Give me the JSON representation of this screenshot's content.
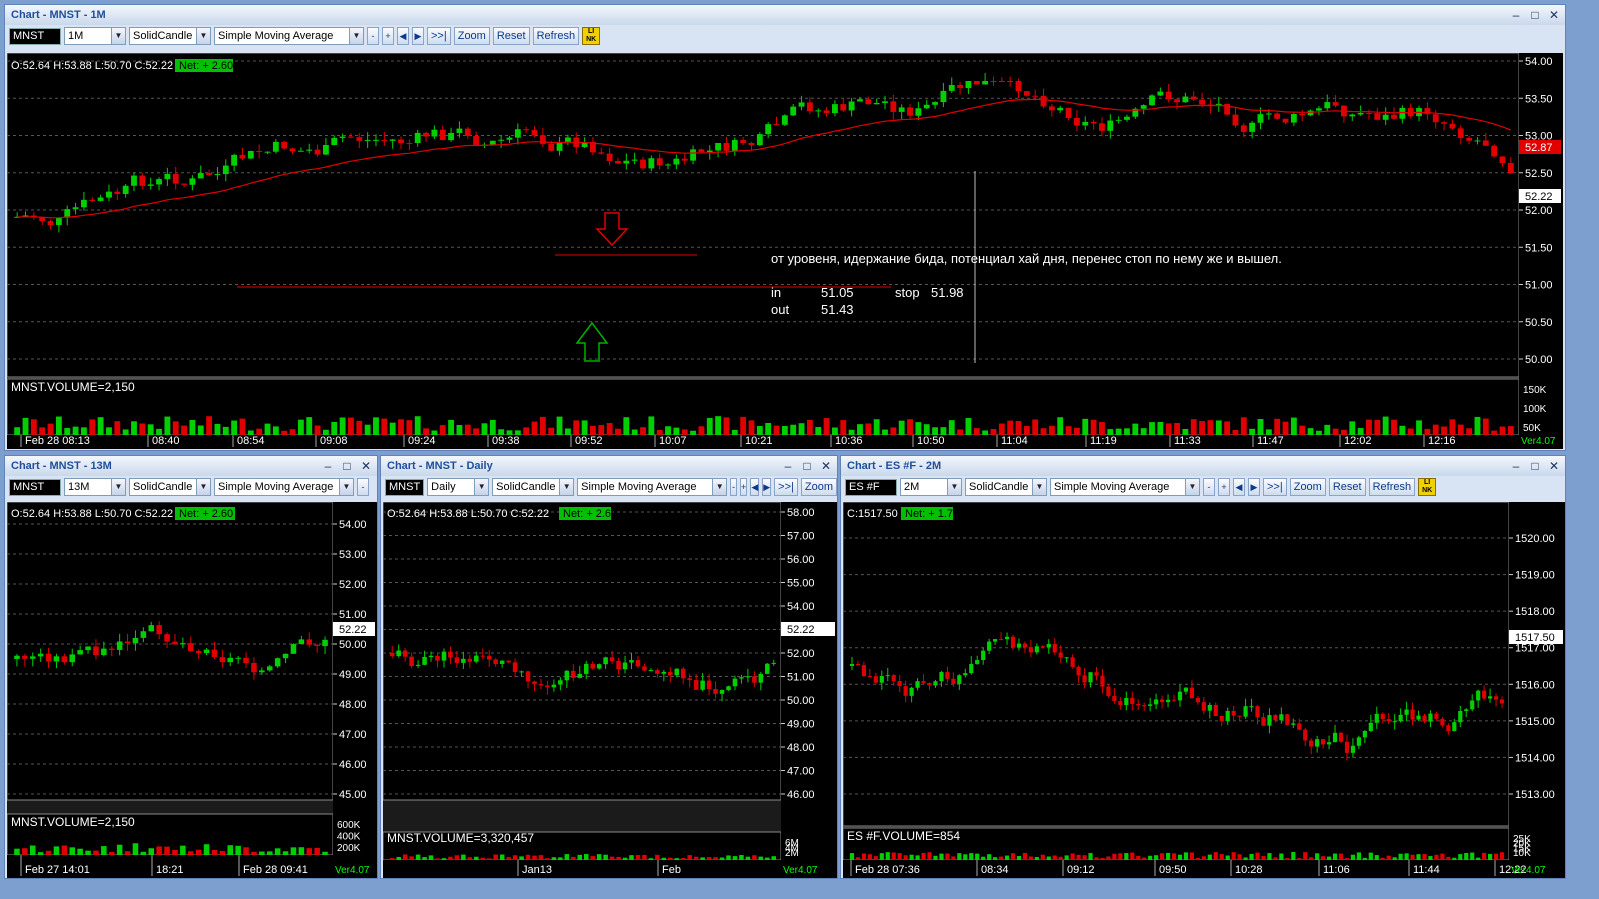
{
  "windows": [
    {
      "id": "w1",
      "title": "Chart - MNST - 1M",
      "symbol": "MNST",
      "interval": "1M",
      "style": "SolidCandle",
      "study": "Simple Moving Average",
      "buttons": [
        "Zoom",
        "Reset",
        "Refresh"
      ],
      "ohlc": "O:52.64  H:53.88  L:50.70  C:52.22",
      "net": "Net: + 2.60",
      "vol_label": "MNST.VOLUME=2,150",
      "price_ticks": [
        "54.00",
        "53.50",
        "53.00",
        "52.50",
        "52.00",
        "51.50",
        "51.00",
        "50.50",
        "50.00"
      ],
      "vol_ticks": [
        "150K",
        "100K",
        "50K"
      ],
      "time_ticks": [
        "Feb 28 08:13",
        "08:40",
        "08:54",
        "09:08",
        "09:24",
        "09:38",
        "09:52",
        "10:07",
        "10:21",
        "10:36",
        "10:50",
        "11:04",
        "11:19",
        "11:33",
        "11:47",
        "12:02",
        "12:16"
      ],
      "last_price": "52.22",
      "ma_price": "52.87",
      "ver": "Ver4.07",
      "annotation": {
        "comment": "от уровеня,  идержание бида, потенциал хай дня, перенес стоп по нему же и вышел.",
        "in_label": "in",
        "in_value": "51.05",
        "stop_label": "stop",
        "stop_value": "51.98",
        "out_label": "out",
        "out_value": "51.43"
      }
    },
    {
      "id": "w2",
      "title": "Chart - MNST - 13M",
      "symbol": "MNST",
      "interval": "13M",
      "style": "SolidCandle",
      "study": "Simple Moving Average",
      "ohlc": "O:52.64  H:53.88  L:50.70  C:52.22",
      "net": "Net: + 2.60",
      "vol_label": "MNST.VOLUME=2,150",
      "price_ticks": [
        "54.00",
        "53.00",
        "52.00",
        "51.00",
        "50.00",
        "49.00",
        "48.00",
        "47.00",
        "46.00",
        "45.00"
      ],
      "vol_ticks": [
        "600K",
        "400K",
        "200K"
      ],
      "time_ticks": [
        "Feb 27 14:01",
        "18:21",
        "Feb 28 09:41"
      ],
      "last_price": "52.22",
      "ver": "Ver4.07"
    },
    {
      "id": "w3",
      "title": "Chart - MNST - Daily",
      "symbol": "MNST",
      "interval": "Daily",
      "style": "SolidCandle",
      "study": "Simple Moving Average",
      "buttons": [
        "Zoom"
      ],
      "ohlc": "O:52.64  H:53.88  L:50.70  C:52.22",
      "net": "Net: + 2.60",
      "vol_label": "MNST.VOLUME=3,320,457",
      "price_ticks": [
        "58.00",
        "57.00",
        "56.00",
        "55.00",
        "54.00",
        "53.00",
        "52.00",
        "51.00",
        "50.00",
        "49.00",
        "48.00",
        "47.00",
        "46.00"
      ],
      "vol_ticks": [
        "6M",
        "4M",
        "2M"
      ],
      "time_ticks": [
        "Jan13",
        "Feb"
      ],
      "last_price": "52.22",
      "ver": "Ver4.07"
    },
    {
      "id": "w4",
      "title": "Chart - ES #F - 2M",
      "symbol": "ES #F",
      "interval": "2M",
      "style": "SolidCandle",
      "study": "Simple Moving Average",
      "buttons": [
        "Zoom",
        "Reset",
        "Refresh"
      ],
      "ohlc": "C:1517.50",
      "net": "Net: + 1.75",
      "vol_label": "ES #F.VOLUME=854",
      "price_ticks": [
        "1520.00",
        "1519.00",
        "1518.00",
        "1517.00",
        "1516.00",
        "1515.00",
        "1514.00",
        "1513.00"
      ],
      "vol_ticks": [
        "25K",
        "20K",
        "15K",
        "10K"
      ],
      "time_ticks": [
        "Feb 28 07:36",
        "08:34",
        "09:12",
        "09:50",
        "10:28",
        "11:06",
        "11:44",
        "12:22"
      ],
      "last_price": "1517.50",
      "ver": "Ver4.07"
    }
  ],
  "colors": {
    "up": "#00d000",
    "down": "#e00000",
    "ma": "#e00000",
    "net_bg": "#00c000",
    "chart_bg": "#000000",
    "grid": "#555555"
  }
}
